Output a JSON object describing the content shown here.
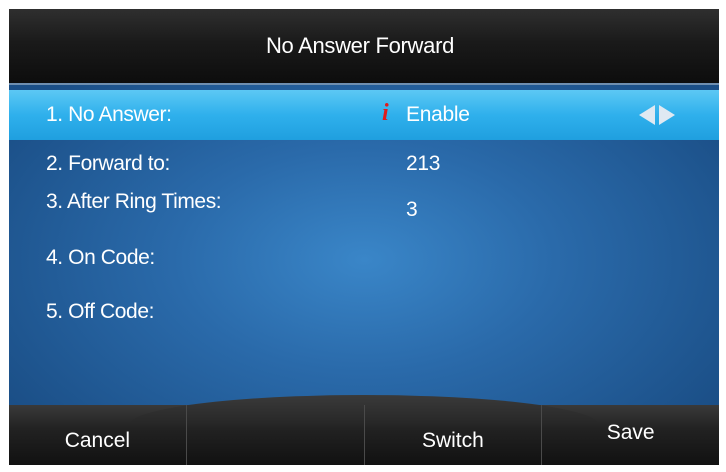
{
  "title": "No Answer Forward",
  "menu": {
    "items": [
      {
        "label": "1. No Answer:",
        "value": "Enable",
        "info_icon": "i"
      },
      {
        "label": "2. Forward to:",
        "value": "213"
      },
      {
        "label": "3. After Ring Times:",
        "value": "3"
      },
      {
        "label": "4. On Code:",
        "value": ""
      },
      {
        "label": "5. Off Code:",
        "value": ""
      }
    ],
    "selected_index": 0
  },
  "softkeys": [
    "Cancel",
    "",
    "Switch",
    "Save"
  ],
  "colors": {
    "selected_row": "#2fb0ec",
    "background": "#2a6aaa",
    "title_bar": "#1a1a1a",
    "info_icon": "#e01c1c"
  },
  "icons": {
    "info": "info-icon",
    "left_arrow": "left-arrow-icon",
    "right_arrow": "right-arrow-icon"
  }
}
